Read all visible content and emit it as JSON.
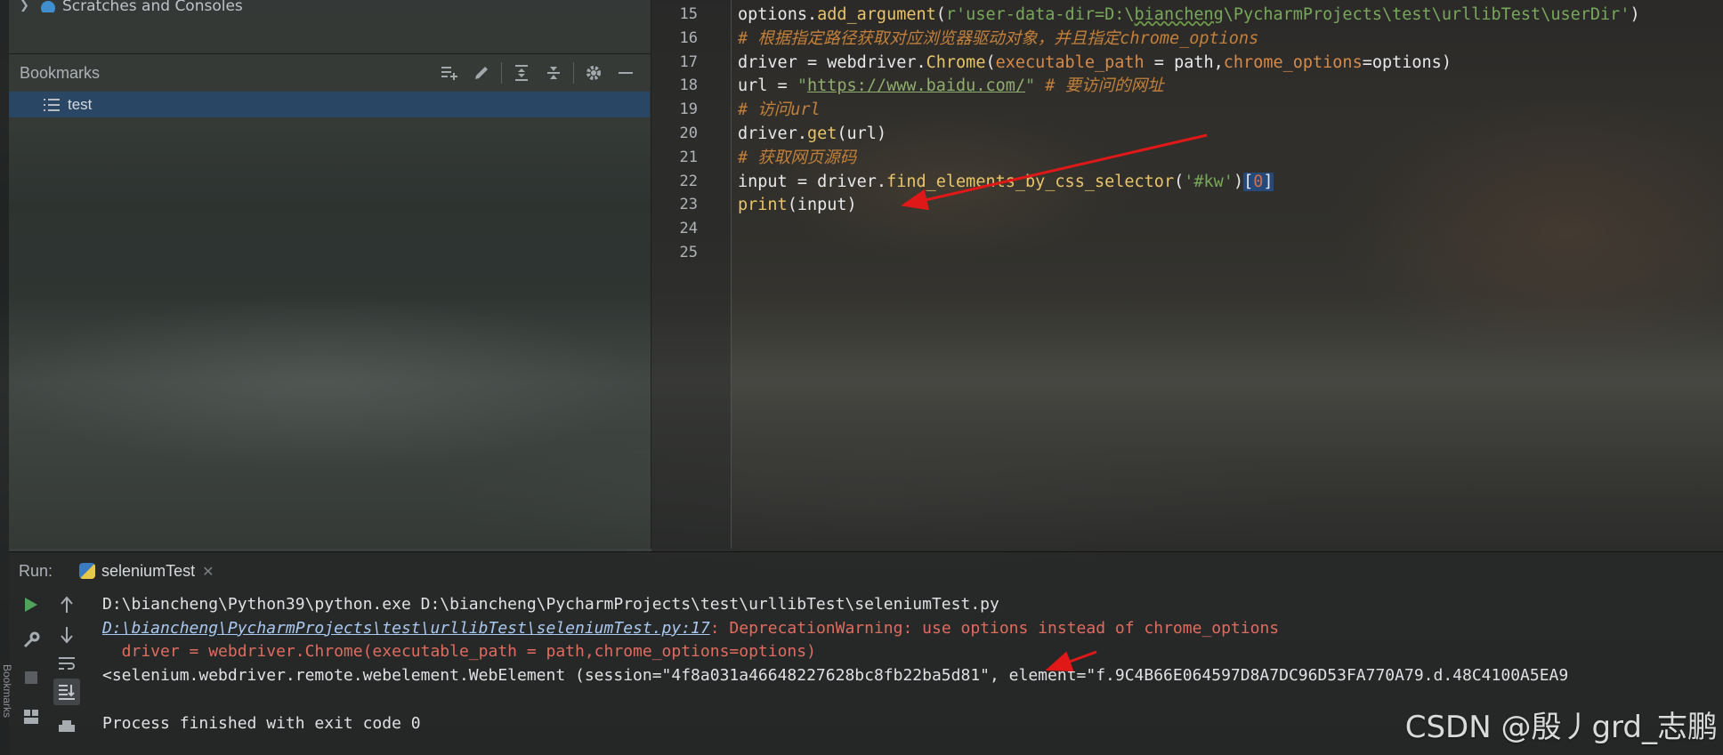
{
  "project_panel": {
    "scratches_label": "Scratches and Consoles",
    "bookmarks_title": "Bookmarks",
    "bookmark_items": [
      {
        "label": "test"
      }
    ]
  },
  "editor": {
    "lines": [
      {
        "num": "15",
        "tokens": [
          {
            "t": "options.",
            "k": "plain"
          },
          {
            "t": "add_argument",
            "k": "fn"
          },
          {
            "t": "(",
            "k": "plain"
          },
          {
            "t": "r'user-data-dir=D:\\",
            "k": "str"
          },
          {
            "t": "biancheng",
            "k": "strsq"
          },
          {
            "t": "\\PycharmProjects\\test\\urllibTest\\userDir'",
            "k": "str"
          },
          {
            "t": ")",
            "k": "plain"
          }
        ]
      },
      {
        "num": "16",
        "tokens": [
          {
            "t": "# 根据指定路径获取对应浏览器驱动对象，并且指定chrome_options",
            "k": "comment"
          }
        ]
      },
      {
        "num": "17",
        "tokens": [
          {
            "t": "driver = webdriver.",
            "k": "plain"
          },
          {
            "t": "Chrome",
            "k": "cls"
          },
          {
            "t": "(",
            "k": "plain"
          },
          {
            "t": "executable_path",
            "k": "kw"
          },
          {
            "t": " = path,",
            "k": "plain"
          },
          {
            "t": "chrome_options",
            "k": "kw"
          },
          {
            "t": "=options)",
            "k": "plain"
          }
        ]
      },
      {
        "num": "18",
        "tokens": [
          {
            "t": "url = ",
            "k": "plain"
          },
          {
            "t": "\"",
            "k": "str"
          },
          {
            "t": "https://www.baidu.com/",
            "k": "url"
          },
          {
            "t": "\"",
            "k": "str"
          },
          {
            "t": " # 要访问的网址",
            "k": "comment"
          }
        ]
      },
      {
        "num": "19",
        "tokens": [
          {
            "t": "# 访问url",
            "k": "comment"
          }
        ]
      },
      {
        "num": "20",
        "tokens": [
          {
            "t": "driver.",
            "k": "plain"
          },
          {
            "t": "get",
            "k": "fn"
          },
          {
            "t": "(url)",
            "k": "plain"
          }
        ]
      },
      {
        "num": "21",
        "tokens": [
          {
            "t": "# 获取网页源码",
            "k": "comment"
          }
        ]
      },
      {
        "num": "22",
        "tokens": [
          {
            "t": "input = driver.",
            "k": "plain"
          },
          {
            "t": "find_elements_by_css_selector",
            "k": "fn"
          },
          {
            "t": "(",
            "k": "plain"
          },
          {
            "t": "'#kw'",
            "k": "str"
          },
          {
            "t": ")",
            "k": "plain"
          },
          {
            "t": "[",
            "k": "brk"
          },
          {
            "t": "0",
            "k": "num"
          },
          {
            "t": "]",
            "k": "brk"
          }
        ]
      },
      {
        "num": "23",
        "tokens": [
          {
            "t": "print",
            "k": "fn"
          },
          {
            "t": "(input)",
            "k": "plain"
          }
        ]
      },
      {
        "num": "24",
        "tokens": []
      },
      {
        "num": "25",
        "tokens": []
      }
    ]
  },
  "run_panel": {
    "label": "Run:",
    "tab_label": "seleniumTest",
    "console": [
      {
        "parts": [
          {
            "t": "D:\\biancheng\\Python39\\python.exe D:\\biancheng\\PycharmProjects\\test\\urllibTest\\seleniumTest.py",
            "k": "plain"
          }
        ]
      },
      {
        "parts": [
          {
            "t": "D:\\biancheng\\PycharmProjects\\test\\urllibTest\\seleniumTest.py:17",
            "k": "link"
          },
          {
            "t": ": DeprecationWarning: use options instead of chrome_options",
            "k": "err"
          }
        ]
      },
      {
        "parts": [
          {
            "t": "  driver = webdriver.Chrome(executable_path = path,chrome_options=options)",
            "k": "err"
          }
        ]
      },
      {
        "parts": [
          {
            "t": "<selenium.webdriver.remote.webelement.WebElement (session=\"4f8a031a46648227628bc8fb22ba5d81\", element=\"f.9C4B66E064597D8A7DC96D53FA770A79.d.48C4100A5EA9",
            "k": "plain"
          }
        ]
      },
      {
        "parts": []
      },
      {
        "parts": [
          {
            "t": "Process finished with exit code 0",
            "k": "plain"
          }
        ]
      }
    ]
  },
  "side_label": "Bookmarks",
  "watermark": "CSDN @殷丿grd_志鹏",
  "colors": {
    "selection": "#284869",
    "string": "#78a85c",
    "comment": "#c2803a",
    "function": "#e8c46a",
    "error": "#e06b5f",
    "arrow": "#e01818"
  }
}
